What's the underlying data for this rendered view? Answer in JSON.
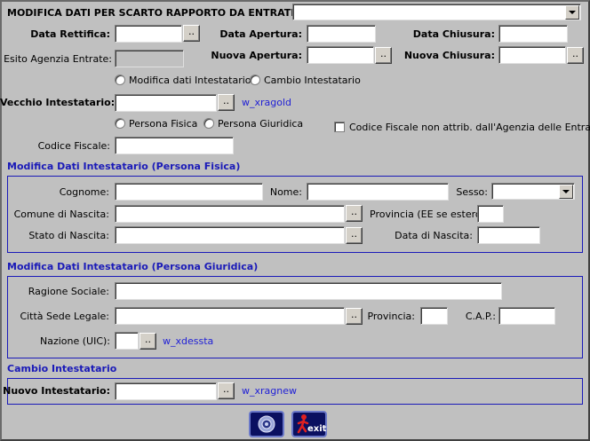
{
  "header": {
    "question": "MODIFICA DATI PER SCARTO RAPPORTO DA ENTRATEL ?",
    "select_value": ""
  },
  "row1": {
    "data_rettifica": "Data Rettifica:",
    "data_apertura": "Data Apertura:",
    "data_chiusura": "Data Chiusura:"
  },
  "row2": {
    "esito": "Esito Agenzia Entrate:",
    "nuova_apertura": "Nuova Apertura:",
    "nuova_chiusura": "Nuova Chiusura:"
  },
  "mode": {
    "modifica": "Modifica dati Intestatario",
    "cambio": "Cambio Intestatario"
  },
  "vecchio": {
    "label": "Vecchio Intestatario:",
    "link": "w_xragold"
  },
  "persona": {
    "fisica": "Persona Fisica",
    "giuridica": "Persona Giuridica",
    "cf_non_attrib": "Codice Fiscale non attrib. dall'Agenzia delle Entrate",
    "codice_fiscale": "Codice Fiscale:"
  },
  "pf": {
    "title": "Modifica Dati Intestatario (Persona Fisica)",
    "cognome": "Cognome:",
    "nome": "Nome:",
    "sesso": "Sesso:",
    "comune": "Comune di Nascita:",
    "provincia": "Provincia (EE se estero)",
    "stato": "Stato di Nascita:",
    "data_nascita": "Data di Nascita:"
  },
  "pg": {
    "title": "Modifica Dati Intestatario (Persona Giuridica)",
    "ragione": "Ragione Sociale:",
    "citta": "Città Sede Legale:",
    "provincia": "Provincia:",
    "cap": "C.A.P.:",
    "nazione": "Nazione (UIC):",
    "nazione_link": "w_xdessta"
  },
  "cambio": {
    "title": "Cambio Intestatario",
    "nuovo": "Nuovo Intestatario:",
    "link": "w_xragnew"
  },
  "buttons": {
    "ellipsis": "..",
    "exit": "exit"
  },
  "colors": {
    "background": "#c0c0c0",
    "section_blue": "#1a1ab8",
    "link_blue": "#1f1fd6"
  }
}
